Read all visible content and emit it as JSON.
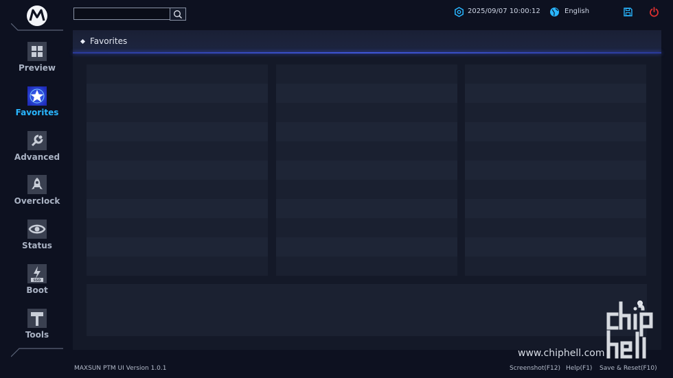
{
  "header": {
    "search": {
      "value": "",
      "placeholder": ""
    },
    "datetime": "2025/09/07 10:00:12",
    "language": "English"
  },
  "sidebar": {
    "items": [
      {
        "label": "Preview",
        "icon": "preview-icon",
        "active": false
      },
      {
        "label": "Favorites",
        "icon": "star-icon",
        "active": true
      },
      {
        "label": "Advanced",
        "icon": "wrench-icon",
        "active": false
      },
      {
        "label": "Overclock",
        "icon": "rocket-icon",
        "active": false
      },
      {
        "label": "Status",
        "icon": "eye-icon",
        "active": false
      },
      {
        "label": "Boot",
        "icon": "ssd-icon",
        "active": false
      },
      {
        "label": "Tools",
        "icon": "hammer-icon",
        "active": false
      }
    ]
  },
  "main": {
    "section_title": "Favorites",
    "columns": 3,
    "rows_per_column": 11
  },
  "footer": {
    "version": "MAXSUN PTM UI Version 1.0.1",
    "screenshot": "Screenshot(F12)",
    "help": "Help(F1)",
    "save_reset": "Save & Reset(F10)"
  },
  "watermark": {
    "url": "www.chiphell.com",
    "logo_text": "chip hell"
  },
  "colors": {
    "accent": "#29b6ff",
    "power": "#e03030",
    "panel_line": "#3f56d8",
    "background": "#0d1120"
  }
}
